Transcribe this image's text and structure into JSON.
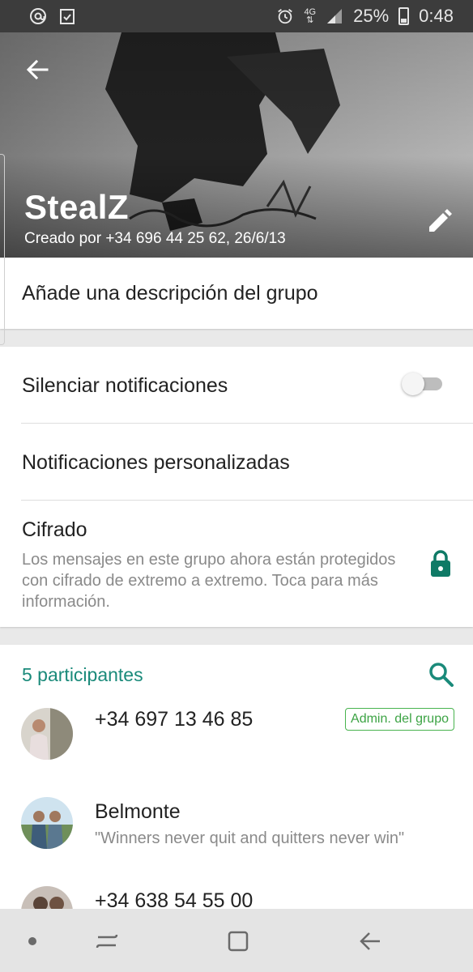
{
  "status_bar": {
    "network": "4G",
    "battery": "25%",
    "time": "0:48"
  },
  "header": {
    "group_name": "StealZ",
    "created_by": "Creado por +34 696 44 25 62, 26/6/13"
  },
  "description": {
    "placeholder": "Añade una descripción del grupo"
  },
  "settings": {
    "mute_label": "Silenciar notificaciones",
    "mute_enabled": false,
    "custom_notifications_label": "Notificaciones personalizadas",
    "encryption_title": "Cifrado",
    "encryption_desc": "Los mensajes en este grupo ahora están protegidos con cifrado de extremo a extremo. Toca para más información."
  },
  "participants": {
    "count_label": "5 participantes",
    "list": [
      {
        "name": "+34 697 13 46 85",
        "status": "",
        "badge": "Admin. del grupo"
      },
      {
        "name": "Belmonte",
        "status": "\"Winners never quit and quitters never win\"",
        "badge": ""
      },
      {
        "name": "+34 638 54 55 00",
        "status": "",
        "badge": ""
      }
    ]
  },
  "colors": {
    "accent": "#1a8a7a",
    "admin_badge": "#48b34e",
    "lock_icon": "#0f7a66"
  }
}
